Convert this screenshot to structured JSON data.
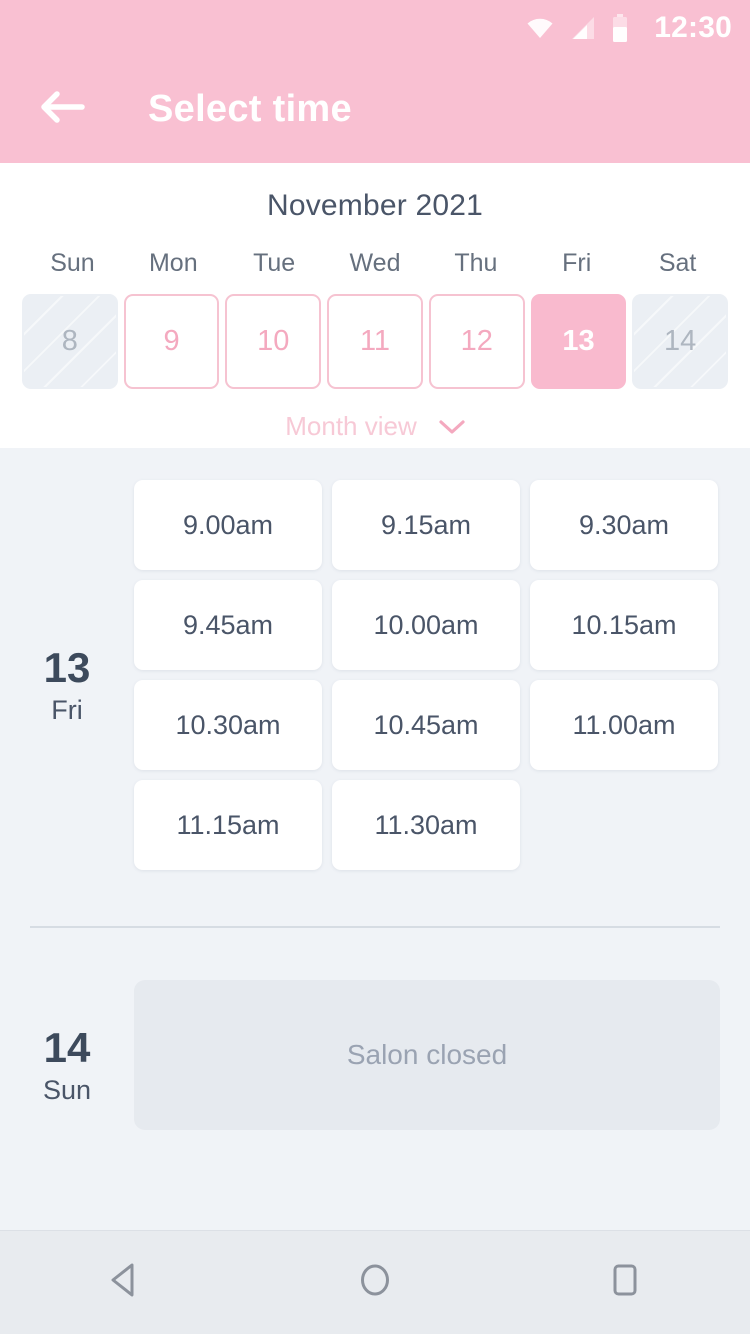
{
  "status_bar": {
    "time": "12:30",
    "icons": [
      "wifi-icon",
      "cellular-signal-icon",
      "battery-icon"
    ]
  },
  "app_bar": {
    "back_icon": "back-arrow-icon",
    "title": "Select time"
  },
  "calendar": {
    "month_title": "November 2021",
    "weekdays": [
      "Sun",
      "Mon",
      "Tue",
      "Wed",
      "Thu",
      "Fri",
      "Sat"
    ],
    "days": [
      {
        "label": "8",
        "state": "disabled"
      },
      {
        "label": "9",
        "state": "available"
      },
      {
        "label": "10",
        "state": "available"
      },
      {
        "label": "11",
        "state": "available"
      },
      {
        "label": "12",
        "state": "available"
      },
      {
        "label": "13",
        "state": "selected"
      },
      {
        "label": "14",
        "state": "disabled"
      }
    ],
    "month_view_label": "Month view",
    "month_view_icon": "chevron-down-icon"
  },
  "schedule": {
    "groups": [
      {
        "day_number": "13",
        "day_of_week": "Fri",
        "slots": [
          "9.00am",
          "9.15am",
          "9.30am",
          "9.45am",
          "10.00am",
          "10.15am",
          "10.30am",
          "10.45am",
          "11.00am",
          "11.15am",
          "11.30am"
        ]
      },
      {
        "day_number": "14",
        "day_of_week": "Sun",
        "closed_message": "Salon closed"
      }
    ]
  },
  "nav_bar": {
    "buttons": [
      "back-triangle-icon",
      "home-circle-icon",
      "recents-square-icon"
    ]
  },
  "colors": {
    "brand_pink": "#F9C0D2",
    "selected_pink": "#F9BACE",
    "day_border_pink": "#F6C3D1",
    "background": "#F0F3F7",
    "text_dark": "#4A5568",
    "muted": "#9AA3B2"
  }
}
